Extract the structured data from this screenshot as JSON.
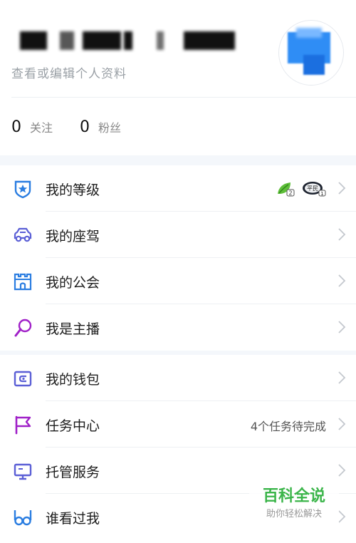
{
  "profile": {
    "edit_profile_label": "查看或编辑个人资料",
    "following_count": "0",
    "following_label": "关注",
    "followers_count": "0",
    "followers_label": "粉丝"
  },
  "menu_group_1": [
    {
      "label": "我的等级",
      "icon": "shield-star-icon"
    },
    {
      "label": "我的座驾",
      "icon": "car-icon"
    },
    {
      "label": "我的公会",
      "icon": "castle-icon"
    },
    {
      "label": "我是主播",
      "icon": "microphone-icon"
    }
  ],
  "level_badges": {
    "badge_1": "2",
    "badge_2_text": "平民",
    "badge_2_num": "1"
  },
  "menu_group_2": [
    {
      "label": "我的钱包",
      "icon": "wallet-icon"
    },
    {
      "label": "任务中心",
      "icon": "flag-icon",
      "extra": "4个任务待完成"
    },
    {
      "label": "托管服务",
      "icon": "monitor-icon"
    },
    {
      "label": "谁看过我",
      "icon": "glasses-icon"
    }
  ],
  "watermark": {
    "title": "百科全说",
    "subtitle": "助你轻松解决"
  },
  "colors": {
    "accent_blue": "#2a7de1",
    "accent_purple": "#8a3ed6",
    "accent_indigo": "#5b5fd6"
  }
}
